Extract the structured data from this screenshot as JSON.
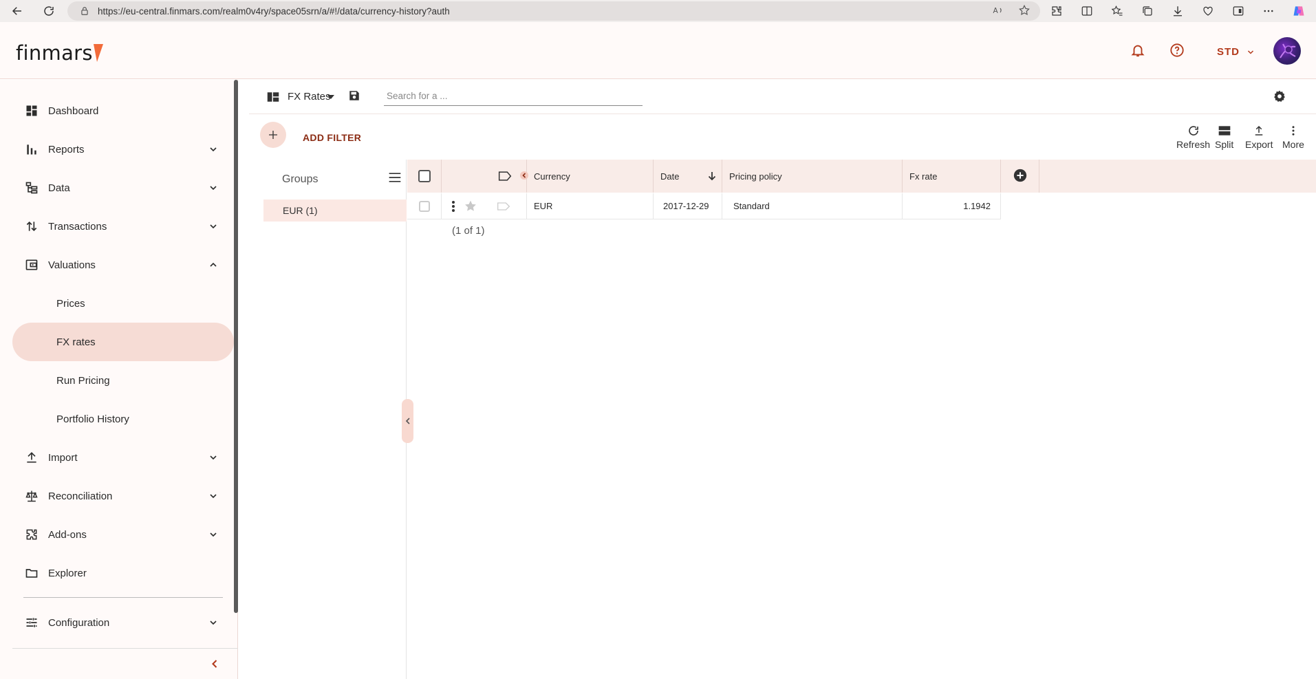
{
  "browser": {
    "url": "https://eu-central.finmars.com/realm0v4ry/space05srn/a/#!/data/currency-history?auth"
  },
  "header": {
    "logo_text": "finmars",
    "space_code": "STD"
  },
  "sidebar": {
    "items": [
      {
        "label": "Dashboard",
        "icon": "dashboard-icon"
      },
      {
        "label": "Reports",
        "icon": "bar-chart-icon"
      },
      {
        "label": "Data",
        "icon": "hierarchy-icon"
      },
      {
        "label": "Transactions",
        "icon": "swap-vertical-icon"
      },
      {
        "label": "Valuations",
        "icon": "wallet-icon"
      },
      {
        "label": "Prices"
      },
      {
        "label": "FX rates"
      },
      {
        "label": "Run Pricing"
      },
      {
        "label": "Portfolio History"
      },
      {
        "label": "Import",
        "icon": "upload-icon"
      },
      {
        "label": "Reconciliation",
        "icon": "scale-icon"
      },
      {
        "label": "Add-ons",
        "icon": "puzzle-icon"
      },
      {
        "label": "Explorer",
        "icon": "folder-icon"
      },
      {
        "label": "Configuration",
        "icon": "tune-icon"
      }
    ]
  },
  "toolbar": {
    "layout_name": "FX Rates",
    "search_placeholder": "Search for a ..."
  },
  "filter_bar": {
    "add_filter_label": "ADD FILTER",
    "refresh_label": "Refresh",
    "split_label": "Split",
    "export_label": "Export",
    "more_label": "More"
  },
  "groups": {
    "title": "Groups",
    "items": [
      {
        "label": "EUR (1)"
      }
    ]
  },
  "table": {
    "columns": [
      "Currency",
      "Date",
      "Pricing policy",
      "Fx rate"
    ],
    "sorted_column": "Date",
    "sort_direction": "descending",
    "rows": [
      {
        "currency": "EUR",
        "date": "2017-12-29",
        "pricing_policy": "Standard",
        "fx_rate": "1.1942"
      }
    ],
    "pager": "(1 of 1)"
  },
  "colors": {
    "accent": "#b33a1c",
    "active_nav": "#f6dcd5",
    "header_row": "#f9ece8"
  }
}
